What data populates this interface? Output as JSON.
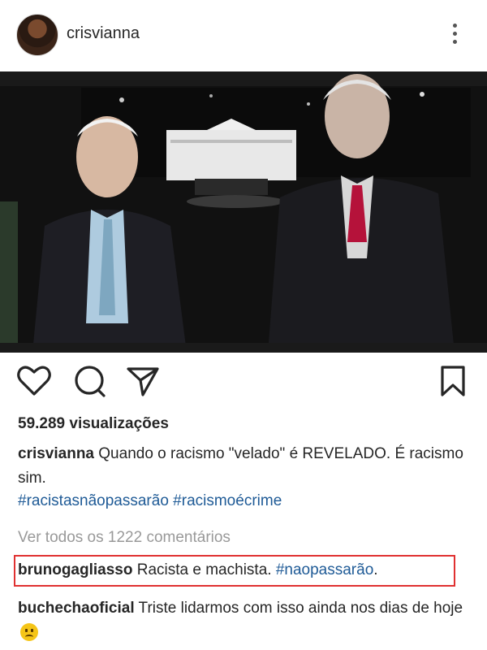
{
  "post": {
    "author": "crisvianna",
    "views": "59.289 visualizações",
    "caption_text": "Quando o racismo \"velado\" é REVELADO. É racismo sim.",
    "hashtags": [
      "#racistasnãopassarão",
      "#racismoécrime"
    ],
    "view_all_comments": "Ver todos os 1222 comentários"
  },
  "icons": {
    "more": "more-vertical-icon",
    "like": "heart-outline-icon",
    "comment": "comment-bubble-icon",
    "share": "paper-plane-icon",
    "save": "bookmark-outline-icon"
  },
  "comments": [
    {
      "user": "brunogagliasso",
      "text": "Racista e machista.",
      "hashtag": "#naopassarão",
      "trail": ".",
      "highlighted": true
    },
    {
      "user": "buchechaoficial",
      "text": "Triste lidarmos com isso ainda nos dias de hoje",
      "emoji": "frowning-face-emoji"
    }
  ],
  "colors": {
    "hashtag": "#1e5a96",
    "muted": "#999999",
    "highlight_border": "#e03131",
    "text": "#262626"
  }
}
